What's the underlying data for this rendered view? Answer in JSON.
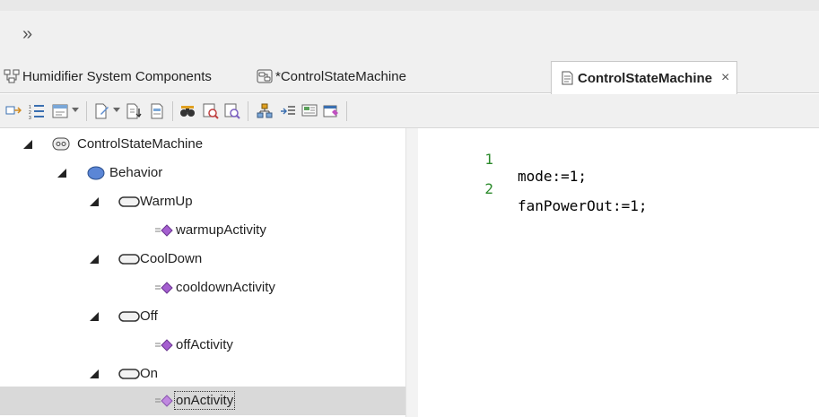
{
  "topbar": {
    "chevron": "»"
  },
  "tabs": [
    {
      "label": "Humidifier System Components",
      "icon": "diagram-icon"
    },
    {
      "label": "*ControlStateMachine",
      "icon": "state-machine-icon"
    },
    {
      "label": "ControlStateMachine",
      "icon": "document-icon",
      "active": true,
      "close": "×"
    }
  ],
  "toolbar": {
    "buttons": [
      "select-icon",
      "numbered-list-icon",
      "properties-icon",
      "edit-icon",
      "import-icon",
      "document-icon",
      "find-icon",
      "search-icon",
      "locate-icon",
      "hierarchy-icon",
      "insert-icon",
      "preview-icon",
      "generate-icon"
    ]
  },
  "tree": {
    "items": [
      {
        "label": "ControlStateMachine",
        "level": 0,
        "icon": "state-machine-icon"
      },
      {
        "label": "Behavior",
        "level": 1,
        "icon": "behavior-icon"
      },
      {
        "label": "WarmUp",
        "level": 2,
        "icon": "state-icon"
      },
      {
        "label": "warmupActivity",
        "level": 3,
        "icon": "activity-icon"
      },
      {
        "label": "CoolDown",
        "level": 2,
        "icon": "state-icon"
      },
      {
        "label": "cooldownActivity",
        "level": 3,
        "icon": "activity-icon"
      },
      {
        "label": "Off",
        "level": 2,
        "icon": "state-icon"
      },
      {
        "label": "offActivity",
        "level": 3,
        "icon": "activity-icon"
      },
      {
        "label": "On",
        "level": 2,
        "icon": "state-icon"
      },
      {
        "label": "onActivity",
        "level": 3,
        "icon": "activity-icon",
        "selected": true
      }
    ]
  },
  "code": {
    "lines": [
      {
        "num": "1",
        "text": "mode:=1;"
      },
      {
        "num": "2",
        "text": "fanPowerOut:=1;"
      }
    ]
  },
  "colors": {
    "selection": "#d9d9d9",
    "line_numbers": "#2b8a2b",
    "accent": "#7b5fc1"
  }
}
